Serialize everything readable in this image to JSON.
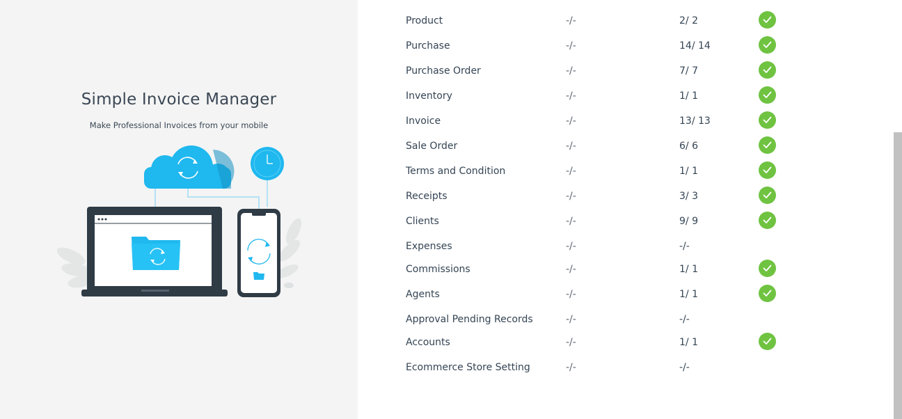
{
  "brand": {
    "title": "Simple Invoice Manager",
    "subtitle": "Make Professional Invoices from your mobile"
  },
  "colors": {
    "left_bg": "#f4f4f4",
    "accent_blue": "#1fb8ef",
    "check_green": "#6fc341",
    "device_dark": "#2f3b45"
  },
  "sync_rows": [
    {
      "name": "Product",
      "server": "-/-",
      "local": "2/ 2",
      "synced": true
    },
    {
      "name": "Purchase",
      "server": "-/-",
      "local": "14/ 14",
      "synced": true
    },
    {
      "name": "Purchase Order",
      "server": "-/-",
      "local": "7/ 7",
      "synced": true
    },
    {
      "name": "Inventory",
      "server": "-/-",
      "local": "1/ 1",
      "synced": true
    },
    {
      "name": "Invoice",
      "server": "-/-",
      "local": "13/ 13",
      "synced": true
    },
    {
      "name": "Sale Order",
      "server": "-/-",
      "local": "6/ 6",
      "synced": true
    },
    {
      "name": "Terms and Condition",
      "server": "-/-",
      "local": "1/ 1",
      "synced": true
    },
    {
      "name": "Receipts",
      "server": "-/-",
      "local": "3/ 3",
      "synced": true
    },
    {
      "name": "Clients",
      "server": "-/-",
      "local": "9/ 9",
      "synced": true
    },
    {
      "name": "Expenses",
      "server": "-/-",
      "local": "-/-",
      "synced": false
    },
    {
      "name": "Commissions",
      "server": "-/-",
      "local": "1/ 1",
      "synced": true
    },
    {
      "name": "Agents",
      "server": "-/-",
      "local": "1/ 1",
      "synced": true
    },
    {
      "name": "Approval Pending Records",
      "server": "-/-",
      "local": "-/-",
      "synced": false
    },
    {
      "name": "Accounts",
      "server": "-/-",
      "local": "1/ 1",
      "synced": true
    },
    {
      "name": "Ecommerce Store Setting",
      "server": "-/-",
      "local": "-/-",
      "synced": false
    }
  ]
}
